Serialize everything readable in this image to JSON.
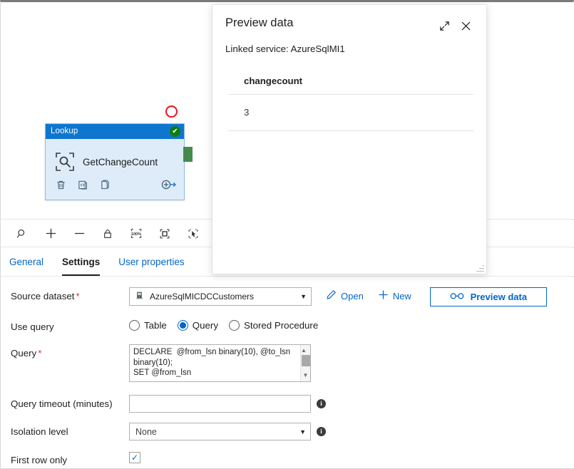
{
  "canvas": {
    "node": {
      "type_label": "Lookup",
      "name": "GetChangeCount",
      "status_icon": "check-icon",
      "status_glyph": "✔",
      "icon": "lookup-magnifier-icon",
      "actions": [
        {
          "name": "delete-activity-icon",
          "label": "Delete"
        },
        {
          "name": "code-view-icon",
          "label": "Code"
        },
        {
          "name": "clone-activity-icon",
          "label": "Clone"
        },
        {
          "name": "add-output-icon",
          "label": "Add output"
        }
      ],
      "header_color": "#0f76cf",
      "body_color": "#deecf9",
      "success_connector_color": "#458b4c",
      "failure_connector_color": "#e81123"
    }
  },
  "toolbar": {
    "buttons": [
      {
        "name": "search-icon",
        "label": "Search"
      },
      {
        "name": "zoom-in-icon",
        "label": "Zoom in"
      },
      {
        "name": "zoom-out-icon",
        "label": "Zoom out"
      },
      {
        "name": "lock-icon",
        "label": "Lock canvas"
      },
      {
        "name": "zoom-100-icon",
        "label": "100%"
      },
      {
        "name": "fit-to-screen-icon",
        "label": "Zoom to fit"
      },
      {
        "name": "select-tool-icon",
        "label": "Select"
      }
    ],
    "zoom_level": "100%"
  },
  "tabs": [
    {
      "label": "General",
      "active": false
    },
    {
      "label": "Settings",
      "active": true
    },
    {
      "label": "User properties",
      "active": false
    }
  ],
  "settings": {
    "source_dataset": {
      "label": "Source dataset",
      "required": true,
      "value": "AzureSqlMICDCCustomers",
      "icon": "database-dataset-icon",
      "open_label": "Open",
      "open_icon": "pencil-icon",
      "new_label": "New",
      "new_icon": "plus-icon",
      "preview_label": "Preview data",
      "preview_icon": "glasses-icon"
    },
    "use_query": {
      "label": "Use query",
      "options": [
        {
          "label": "Table",
          "selected": false
        },
        {
          "label": "Query",
          "selected": true
        },
        {
          "label": "Stored Procedure",
          "selected": false
        }
      ]
    },
    "query": {
      "label": "Query",
      "required": true,
      "value": "DECLARE  @from_lsn binary(10), @to_lsn binary(10);\nSET @from_lsn"
    },
    "query_timeout": {
      "label": "Query timeout (minutes)",
      "value": "",
      "placeholder": "",
      "info_icon": "info-icon"
    },
    "isolation_level": {
      "label": "Isolation level",
      "value": "None",
      "info_icon": "info-icon"
    },
    "first_row_only": {
      "label": "First row only",
      "checked": true,
      "check_glyph": "✓"
    }
  },
  "preview_panel": {
    "title": "Preview data",
    "expand_icon": "expand-diagonal-icon",
    "close_icon": "close-icon",
    "linked_service": "Linked service: AzureSqlMI1",
    "table": {
      "columns": [
        "changecount"
      ],
      "rows": [
        [
          "3"
        ]
      ]
    },
    "resize_handle": "resize-grip"
  }
}
